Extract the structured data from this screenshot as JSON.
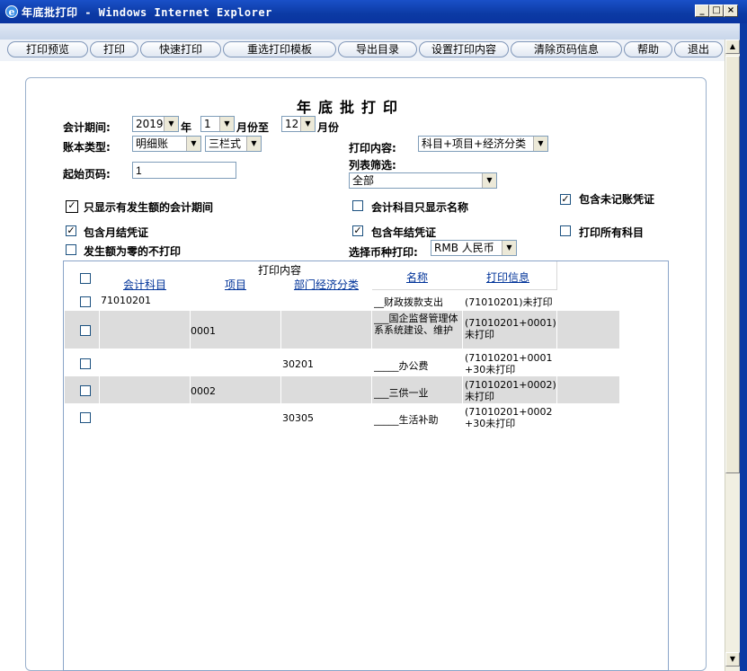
{
  "window": {
    "title": "年底批打印 - Windows Internet Explorer"
  },
  "toolbar": {
    "buttons": [
      "打印预览",
      "打印",
      "快速打印",
      "重选打印模板",
      "导出目录",
      "设置打印内容",
      "清除页码信息",
      "帮助",
      "退出"
    ]
  },
  "page": {
    "title": "年底批打印"
  },
  "form": {
    "period_label": "会计期间:",
    "period_year": "2019",
    "year_unit": "年",
    "period_from": "1",
    "month_to": "月份至",
    "period_to": "12",
    "month_unit": "月份",
    "book_type_label": "账本类型:",
    "book_type": "明细账",
    "book_format": "三栏式",
    "print_content_label": "打印内容:",
    "print_content": "科目+项目+经济分类",
    "start_page_label": "起始页码:",
    "start_page": "1",
    "list_filter_label": "列表筛选:",
    "list_filter": "全部",
    "currency_label": "选择币种打印:",
    "currency": "RMB 人民币"
  },
  "options": {
    "only_active_periods": {
      "label": "只显示有发生额的会计期间",
      "checked": true
    },
    "subject_name_only": {
      "label": "会计科目只显示名称",
      "checked": false
    },
    "include_unposted": {
      "label": "包含未记账凭证",
      "checked": true
    },
    "include_monthly_close": {
      "label": "包含月结凭证",
      "checked": true
    },
    "include_yearly_close": {
      "label": "包含年结凭证",
      "checked": true
    },
    "print_all_subjects": {
      "label": "打印所有科目",
      "checked": false
    },
    "skip_zero": {
      "label": "发生额为零的不打印",
      "checked": false
    }
  },
  "grid": {
    "group_header": "打印内容",
    "columns": [
      "会计科目",
      "项目",
      "部门经济分类",
      "名称",
      "打印信息"
    ],
    "rows": [
      {
        "subject": "71010201",
        "project": "",
        "dept": "",
        "name": "__财政拨款支出",
        "info": "(71010201)未打印"
      },
      {
        "subject": "",
        "project": "0001",
        "dept": "",
        "name": "___国企监督管理体系系统建设、维护",
        "info": "(71010201+0001)未打印"
      },
      {
        "subject": "",
        "project": "",
        "dept": "30201",
        "name": "_____办公费",
        "info": "(71010201+0001+30未打印"
      },
      {
        "subject": "",
        "project": "0002",
        "dept": "",
        "name": "___三供一业",
        "info": "(71010201+0002)未打印"
      },
      {
        "subject": "",
        "project": "",
        "dept": "30305",
        "name": "_____生活补助",
        "info": "(71010201+0002+30未打印"
      }
    ]
  },
  "colors": {
    "titlebar": "#0b3aa4",
    "row_alt": "#dcdcdc",
    "link": "#003399"
  }
}
